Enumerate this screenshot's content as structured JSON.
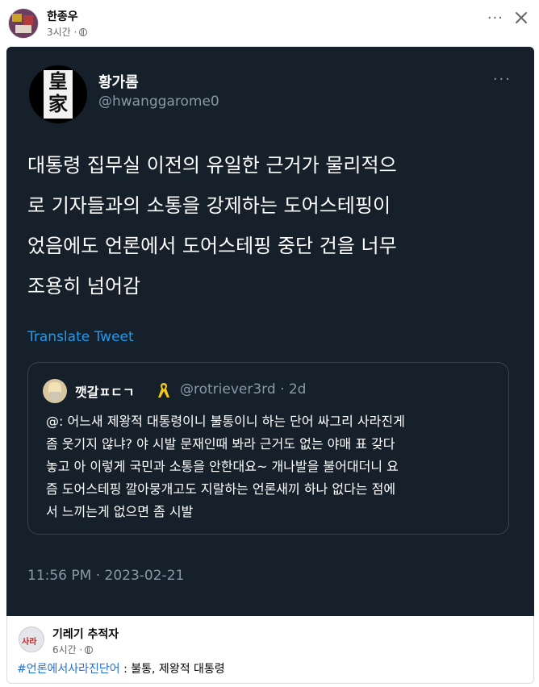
{
  "post": {
    "author": "한종우",
    "time": "3시간 ·"
  },
  "tweet": {
    "name": "황가롬",
    "handle": "@hwanggarome0",
    "avatar_chars": [
      "皇",
      "家"
    ],
    "body_lines": [
      "대통령 집무실 이전의 유일한 근거가 물리적으",
      "로 기자들과의 소통을 강제하는 도어스테핑이",
      "었음에도 언론에서 도어스테핑 중단 건을 너무",
      "조용히 넘어감"
    ],
    "translate_label": "Translate Tweet",
    "quote": {
      "name": "깻갈ㅍㄷㄱ",
      "handle": "@rotriever3rd · 2d",
      "body_lines": [
        "@: 어느새 제왕적 대통령이니 불통이니 하는 단어 싸그리 사라진게",
        "좀 웃기지 않냐? 야 시발 문재인때 봐라 근거도 없는 야매 표 갖다",
        "놓고 아 이렇게 국민과 소통을 안한대요~ 개나발을 불어대더니 요",
        "즘 도어스테핑 깔아뭉개고도 지랄하는 언론새끼 하나 없다는 점에",
        "서 느끼는게 없으면 좀 시발"
      ]
    },
    "timestamp": "11:56 PM · 2023-02-21"
  },
  "shared": {
    "author": "기레기 추적자",
    "avatar_text": "사라",
    "time": "6시간 ·",
    "hashtag": "#언론에서사라진단어",
    "text": " : 불통, 제왕적 대통령"
  },
  "icons": [
    "globe-icon",
    "more-icon",
    "close-icon",
    "yellow-ribbon-icon"
  ],
  "colors": {
    "tweet_bg": "#15202b",
    "link_blue": "#1d9bf0",
    "hashtag_blue": "#216fdb",
    "muted": "#8899a6"
  }
}
